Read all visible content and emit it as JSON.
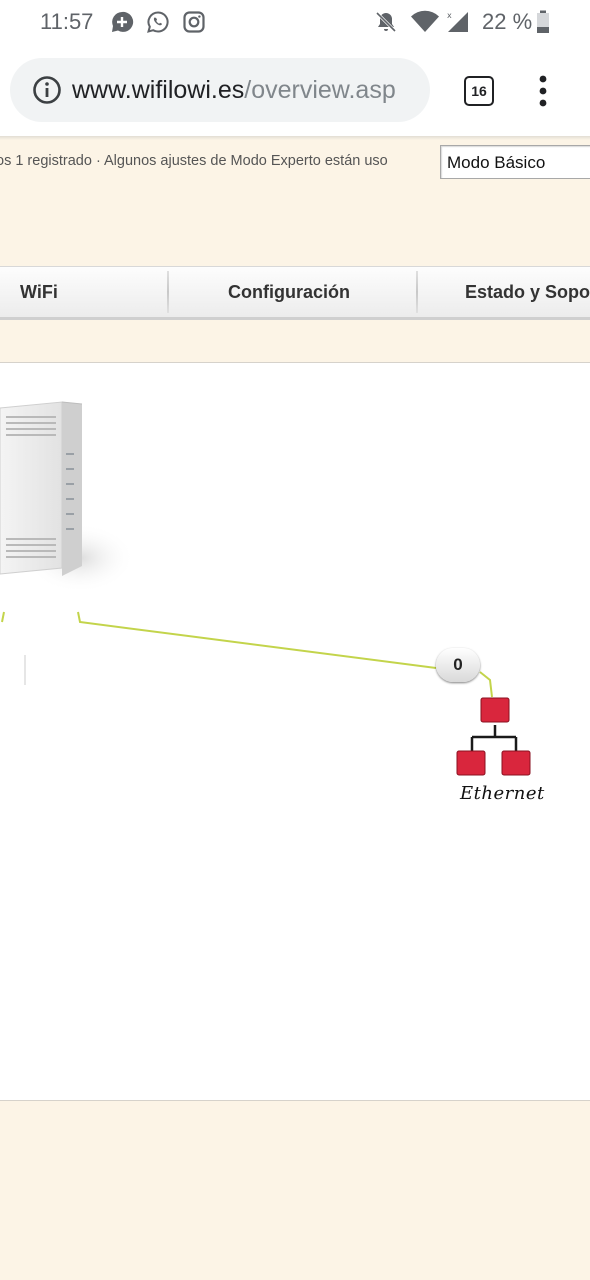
{
  "status_bar": {
    "time": "11:57",
    "notification_icons": [
      "chat-plus-icon",
      "whatsapp-icon",
      "instagram-icon"
    ],
    "system_icons": [
      "bell-off-icon",
      "wifi-icon",
      "signal-icon",
      "battery-icon"
    ],
    "battery": "22 %"
  },
  "browser": {
    "url_host": "www.wifilowi.es",
    "url_path": "/overview.asp",
    "tab_count": "16"
  },
  "header": {
    "info_text": "os 1 registrado · Algunos ajustes de Modo Experto están uso",
    "mode_select": {
      "selected": "Modo Básico"
    }
  },
  "tabs": [
    {
      "label": "WiFi"
    },
    {
      "label": "Configuración"
    },
    {
      "label": "Estado y Soporte"
    }
  ],
  "diagram": {
    "device_count": "0",
    "network_label": "Ethernet",
    "colors": {
      "line": "#c3d44b",
      "node": "#d9263d"
    }
  }
}
